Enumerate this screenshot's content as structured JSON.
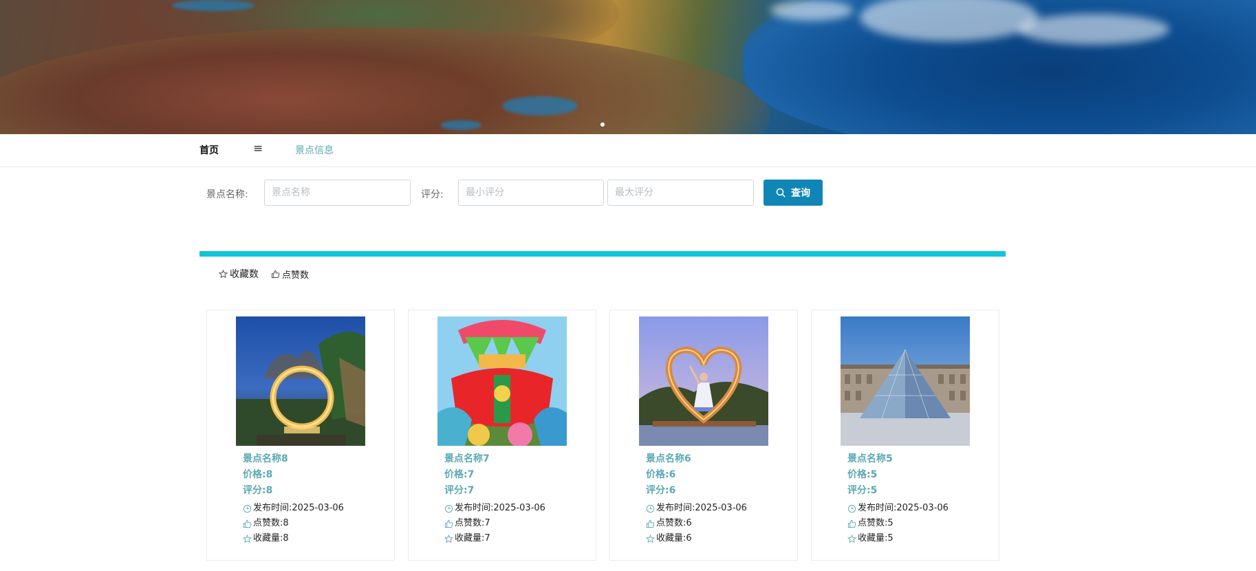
{
  "nav": {
    "home": "首页",
    "menu_icon": "≡",
    "info": "景点信息"
  },
  "search": {
    "name_label": "景点名称:",
    "name_placeholder": "景点名称",
    "score_label": "评分:",
    "min_placeholder": "最小评分",
    "max_placeholder": "最大评分",
    "button_label": "查询"
  },
  "sort": {
    "favorites": "收藏数",
    "likes": "点赞数"
  },
  "cards": [
    {
      "name": "景点名称8",
      "price": "价格:8",
      "score": "评分:8",
      "time": "发布时间:2025-03-06",
      "likes": "点赞数:8",
      "favs": "收藏量:8"
    },
    {
      "name": "景点名称7",
      "price": "价格:7",
      "score": "评分:7",
      "time": "发布时间:2025-03-06",
      "likes": "点赞数:7",
      "favs": "收藏量:7"
    },
    {
      "name": "景点名称6",
      "price": "价格:6",
      "score": "评分:6",
      "time": "发布时间:2025-03-06",
      "likes": "点赞数:6",
      "favs": "收藏量:6"
    },
    {
      "name": "景点名称5",
      "price": "价格:5",
      "score": "评分:5",
      "time": "发布时间:2025-03-06",
      "likes": "点赞数:5",
      "favs": "收藏量:5"
    }
  ],
  "colors": {
    "accent": "#10c5da",
    "button": "#0f86b6",
    "link": "#5aa9b4"
  },
  "icons": {
    "menu": "menu-icon",
    "search": "search-icon",
    "star": "star-icon",
    "thumb": "thumbs-up-icon",
    "clock": "clock-icon"
  }
}
